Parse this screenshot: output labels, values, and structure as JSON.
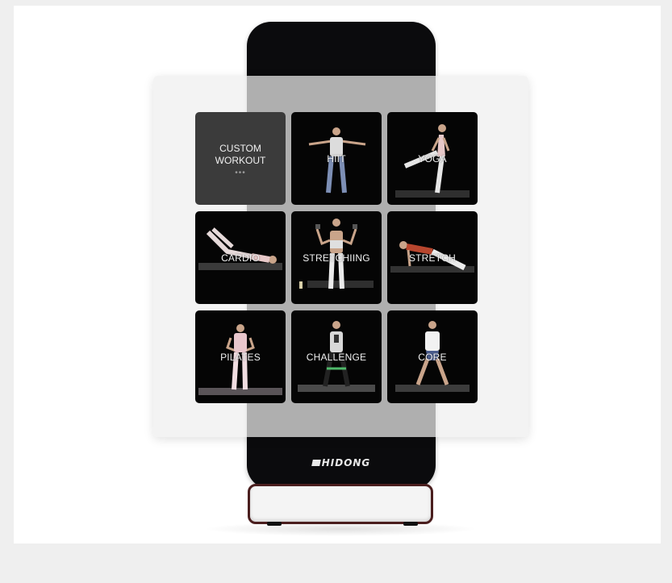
{
  "brand": {
    "name": "HIDONG"
  },
  "custom_tile": {
    "line1": "CUSTOM",
    "line2": "WORKOUT",
    "more": "•••"
  },
  "tiles": [
    {
      "label": "HIIT"
    },
    {
      "label": "YOGA"
    },
    {
      "label": "CARDIO"
    },
    {
      "label": "STRETCHIING"
    },
    {
      "label": "STRETCH"
    },
    {
      "label": "PILATES"
    },
    {
      "label": "CHALLENGE"
    },
    {
      "label": "CORE"
    }
  ],
  "colors": {
    "device": "#0b0b0d",
    "stand_frame": "#4a1e1e",
    "panel": "#eeeeee",
    "tile_bg": "#050505",
    "custom_tile_bg": "#3b3b3b"
  }
}
